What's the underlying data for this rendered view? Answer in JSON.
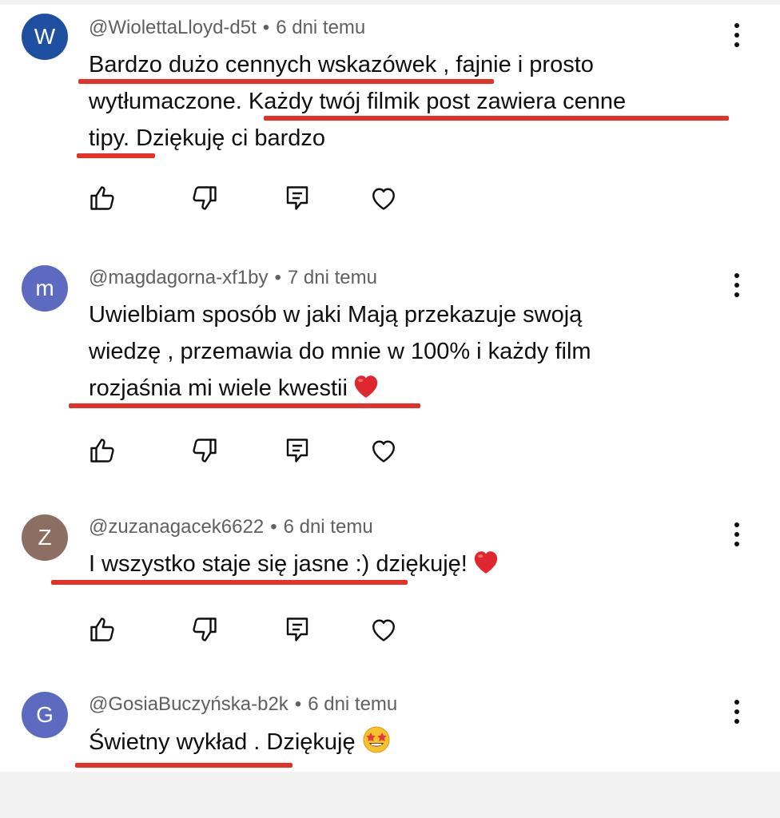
{
  "comments": [
    {
      "avatar_letter": "W",
      "avatar_color": "#1f4fa0",
      "author": "@WiolettaLloyd-d5t",
      "separator": "•",
      "time": "6 dni temu",
      "lines": [
        "Bardzo dużo cennych wskazówek , fajnie i prosto",
        "wytłumaczone. Każdy twój filmik post zawiera cenne",
        "tipy. Dziękuję ci bardzo"
      ]
    },
    {
      "avatar_letter": "m",
      "avatar_color": "#5c6bc0",
      "author": "@magdagorna-xf1by",
      "separator": "•",
      "time": "7 dni temu",
      "lines": [
        "Uwielbiam sposób w jaki Mają przekazuje swoją",
        "wiedzę , przemawia do mnie w 100% i każdy film",
        "rozjaśnia mi wiele kwestii"
      ]
    },
    {
      "avatar_letter": "Z",
      "avatar_color": "#8d6e63",
      "author": "@zuzanagacek6622",
      "separator": "•",
      "time": "6 dni temu",
      "lines": [
        "I wszystko staje się jasne :) dziękuję!"
      ]
    },
    {
      "avatar_letter": "G",
      "avatar_color": "#5c6bc0",
      "author": "@GosiaBuczyńska-b2k",
      "separator": "•",
      "time": "6 dni temu",
      "lines": [
        "Świetny wykład . Dziękuję"
      ]
    }
  ],
  "icons": {
    "like": "thumbs-up-icon",
    "dislike": "thumbs-down-icon",
    "reply": "reply-icon",
    "heart": "heart-icon",
    "more": "more-vertical-icon",
    "heart_emoji": "red-heart-emoji",
    "star_struck_emoji": "star-struck-emoji"
  },
  "colors": {
    "underline": "#e53228",
    "meta_text": "#606060",
    "body_text": "#0f0f0f"
  }
}
